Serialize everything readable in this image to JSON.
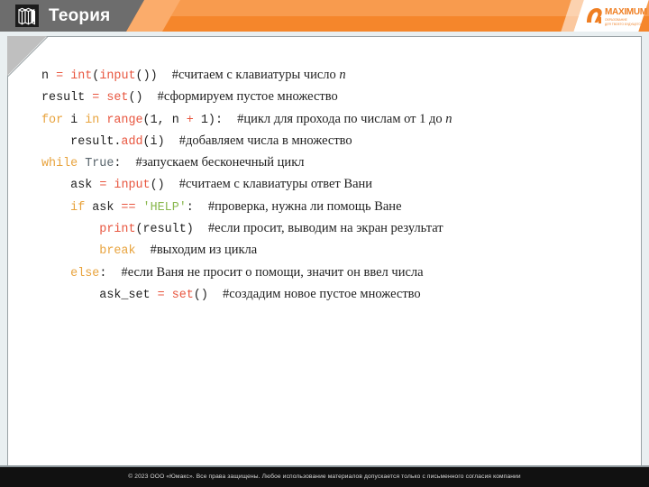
{
  "header": {
    "title": "Теория",
    "icon": "books-icon",
    "bg_orange_light": "#f89b4e",
    "bg_orange_dark": "#f5862b",
    "bg_gray": "#6d6d6d"
  },
  "logo": {
    "name": "MAXIMUM",
    "subtitle_line1": "ОБРАЗОВАНИЕ",
    "subtitle_line2": "ДЛЯ ТВОЕГО БУДУЩЕГО",
    "accent": "#ef7f23"
  },
  "code": {
    "language": "python",
    "lines": [
      {
        "indent": 0,
        "tokens": [
          {
            "t": "n",
            "c": "plain"
          },
          {
            "t": " ",
            "c": "plain"
          },
          {
            "t": "=",
            "c": "op"
          },
          {
            "t": " ",
            "c": "plain"
          },
          {
            "t": "int",
            "c": "fn"
          },
          {
            "t": "(",
            "c": "plain"
          },
          {
            "t": "input",
            "c": "fn"
          },
          {
            "t": "())",
            "c": "plain"
          }
        ],
        "comment": "#считаем с клавиатуры число ",
        "comment_italic": "n"
      },
      {
        "indent": 0,
        "tokens": [
          {
            "t": "result",
            "c": "plain"
          },
          {
            "t": " ",
            "c": "plain"
          },
          {
            "t": "=",
            "c": "op"
          },
          {
            "t": " ",
            "c": "plain"
          },
          {
            "t": "set",
            "c": "fn"
          },
          {
            "t": "()",
            "c": "plain"
          }
        ],
        "comment": "#сформируем пустое множество",
        "comment_italic": ""
      },
      {
        "indent": 0,
        "tokens": [
          {
            "t": "for",
            "c": "kw"
          },
          {
            "t": " i ",
            "c": "plain"
          },
          {
            "t": "in",
            "c": "kw"
          },
          {
            "t": " ",
            "c": "plain"
          },
          {
            "t": "range",
            "c": "fn"
          },
          {
            "t": "(",
            "c": "plain"
          },
          {
            "t": "1",
            "c": "num"
          },
          {
            "t": ", n ",
            "c": "plain"
          },
          {
            "t": "+",
            "c": "op"
          },
          {
            "t": " ",
            "c": "plain"
          },
          {
            "t": "1",
            "c": "num"
          },
          {
            "t": "):",
            "c": "plain"
          }
        ],
        "comment": "#цикл для прохода по числам от 1 до ",
        "comment_italic": "n"
      },
      {
        "indent": 1,
        "tokens": [
          {
            "t": "result.",
            "c": "plain"
          },
          {
            "t": "add",
            "c": "fn"
          },
          {
            "t": "(i)",
            "c": "plain"
          }
        ],
        "comment": "#добавляем числа в множество",
        "comment_italic": ""
      },
      {
        "indent": 0,
        "tokens": [
          {
            "t": "while",
            "c": "kw"
          },
          {
            "t": " ",
            "c": "plain"
          },
          {
            "t": "True",
            "c": "builtin"
          },
          {
            "t": ":",
            "c": "plain"
          }
        ],
        "comment": "#запускаем бесконечный цикл",
        "comment_italic": ""
      },
      {
        "indent": 1,
        "tokens": [
          {
            "t": "ask",
            "c": "plain"
          },
          {
            "t": " ",
            "c": "plain"
          },
          {
            "t": "=",
            "c": "op"
          },
          {
            "t": " ",
            "c": "plain"
          },
          {
            "t": "input",
            "c": "fn"
          },
          {
            "t": "()",
            "c": "plain"
          }
        ],
        "comment": "#считаем с клавиатуры ответ Вани",
        "comment_italic": ""
      },
      {
        "indent": 1,
        "tokens": [
          {
            "t": "if",
            "c": "kw"
          },
          {
            "t": " ask ",
            "c": "plain"
          },
          {
            "t": "==",
            "c": "op"
          },
          {
            "t": " ",
            "c": "plain"
          },
          {
            "t": "'HELP'",
            "c": "str"
          },
          {
            "t": ":",
            "c": "plain"
          }
        ],
        "comment": "#проверка, нужна ли помощь Ване",
        "comment_italic": ""
      },
      {
        "indent": 2,
        "tokens": [
          {
            "t": "print",
            "c": "fn"
          },
          {
            "t": "(result)",
            "c": "plain"
          }
        ],
        "comment": "#если просит, выводим на экран результат",
        "comment_italic": ""
      },
      {
        "indent": 2,
        "tokens": [
          {
            "t": "break",
            "c": "kw"
          }
        ],
        "comment": "#выходим из цикла",
        "comment_italic": ""
      },
      {
        "indent": 1,
        "tokens": [
          {
            "t": "else",
            "c": "kw"
          },
          {
            "t": ":",
            "c": "plain"
          }
        ],
        "comment": "#если Ваня не просит о помощи, значит он ввел числа",
        "comment_italic": ""
      },
      {
        "indent": 2,
        "tokens": [
          {
            "t": "ask_set",
            "c": "plain"
          },
          {
            "t": " ",
            "c": "plain"
          },
          {
            "t": "=",
            "c": "op"
          },
          {
            "t": " ",
            "c": "plain"
          },
          {
            "t": "set",
            "c": "fn"
          },
          {
            "t": "()",
            "c": "plain"
          }
        ],
        "comment": "#создадим новое пустое множество",
        "comment_italic": ""
      }
    ]
  },
  "footer": {
    "text": "© 2023 ООО «Юмакс». Все права защищены. Любое использование материалов допускается только с  письменного согласия компании"
  }
}
